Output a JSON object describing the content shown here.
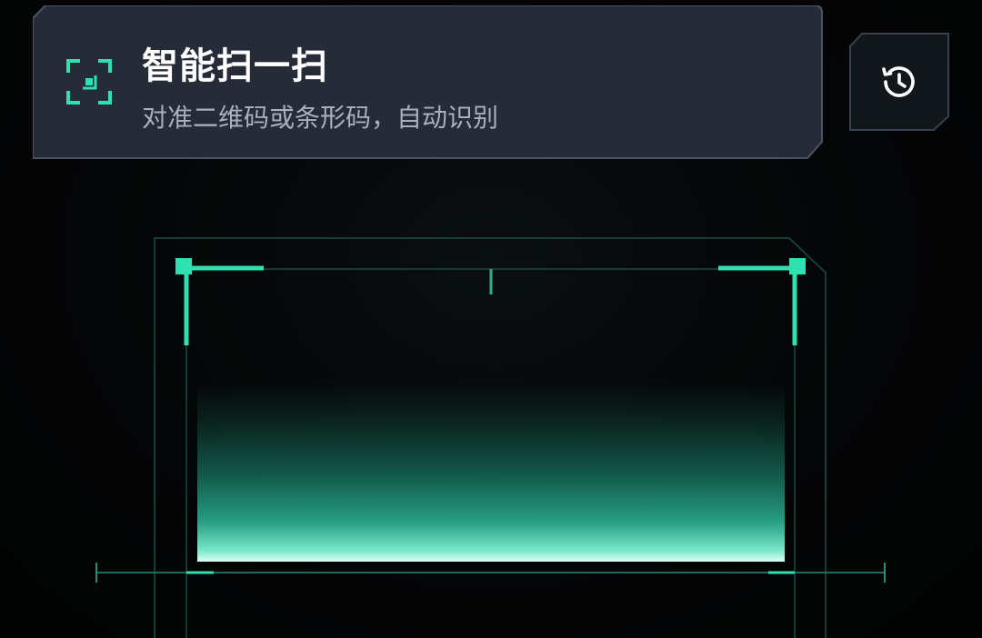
{
  "header": {
    "title": "智能扫一扫",
    "subtitle": "对准二维码或条形码，自动识别",
    "icon": "scan-frame-icon"
  },
  "history_button": {
    "icon": "history-clock-icon"
  },
  "scan_area": {
    "icon": "scan-viewfinder"
  },
  "colors": {
    "accent": "#2fe0b0",
    "card_bg": "#252c37",
    "card_border": "#4a5463",
    "frame_line": "#1e5e52",
    "background": "#030405"
  }
}
